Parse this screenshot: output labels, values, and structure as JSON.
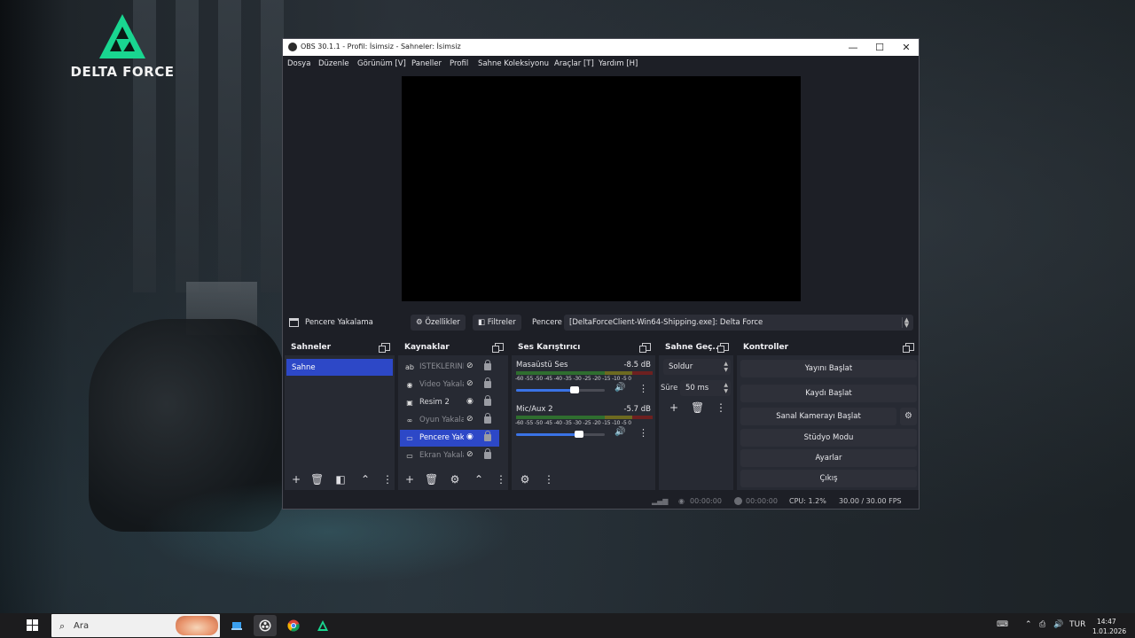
{
  "desktop": {
    "game_logo_text": "DELTA FORCE"
  },
  "obs": {
    "title": "OBS 30.1.1 - Profil: İsimsiz - Sahneler: İsimsiz",
    "window_controls": {
      "minimize": "—",
      "maximize": "☐",
      "close": "✕"
    },
    "menu": [
      "Dosya",
      "Düzenle",
      "Görünüm [V]",
      "Paneller",
      "Profil",
      "Sahne Koleksiyonu",
      "Araçlar [T]",
      "Yardım [H]"
    ],
    "source_toolbar": {
      "source_name": "Pencere Yakalama",
      "properties_label": "Özellikler",
      "filters_label": "Filtreler",
      "window_label": "Pencere",
      "window_value": "[DeltaForceClient-Win64-Shipping.exe]: Delta Force"
    },
    "docks": {
      "scenes": {
        "title": "Sahneler",
        "items": [
          "Sahne"
        ]
      },
      "sources": {
        "title": "Kaynaklar",
        "items": [
          {
            "label": "İSTEKLERİNİ",
            "icon": "text-icon",
            "visible": false,
            "selected": false
          },
          {
            "label": "Video Yakala",
            "icon": "camera-icon",
            "visible": false,
            "selected": false
          },
          {
            "label": "Resim 2",
            "icon": "image-icon",
            "visible": true,
            "selected": false
          },
          {
            "label": "Oyun Yakala",
            "icon": "gamepad-icon",
            "visible": false,
            "selected": false
          },
          {
            "label": "Pencere Yak",
            "icon": "window-icon",
            "visible": true,
            "selected": true
          },
          {
            "label": "Ekran Yakala",
            "icon": "monitor-icon",
            "visible": false,
            "selected": false
          }
        ]
      },
      "mixer": {
        "title": "Ses Karıştırıcı",
        "channels": [
          {
            "name": "Masaüstü Ses",
            "db": "-8.5 dB",
            "volume": 0.66
          },
          {
            "name": "Mic/Aux 2",
            "db": "-5.7 dB",
            "volume": 0.71
          }
        ],
        "scale": "-60 -55 -50 -45 -40 -35 -30 -25 -20 -15 -10  -5   0"
      },
      "transitions": {
        "title": "Sahne Geç...",
        "type": "Soldur",
        "duration_label": "Süre",
        "duration_value": "50 ms"
      },
      "controls": {
        "title": "Kontroller",
        "buttons": [
          "Yayını Başlat",
          "Kaydı Başlat",
          "Sanal Kamerayı Başlat",
          "Stüdyo Modu",
          "Ayarlar",
          "Çıkış"
        ]
      }
    },
    "status": {
      "stream_time": "00:00:00",
      "rec_time": "00:00:00",
      "cpu": "CPU: 1.2%",
      "fps": "30.00 / 30.00 FPS"
    }
  },
  "taskbar": {
    "search_placeholder": "Ara",
    "language": "TUR",
    "time": "14:47",
    "date": "1.01.2026"
  }
}
